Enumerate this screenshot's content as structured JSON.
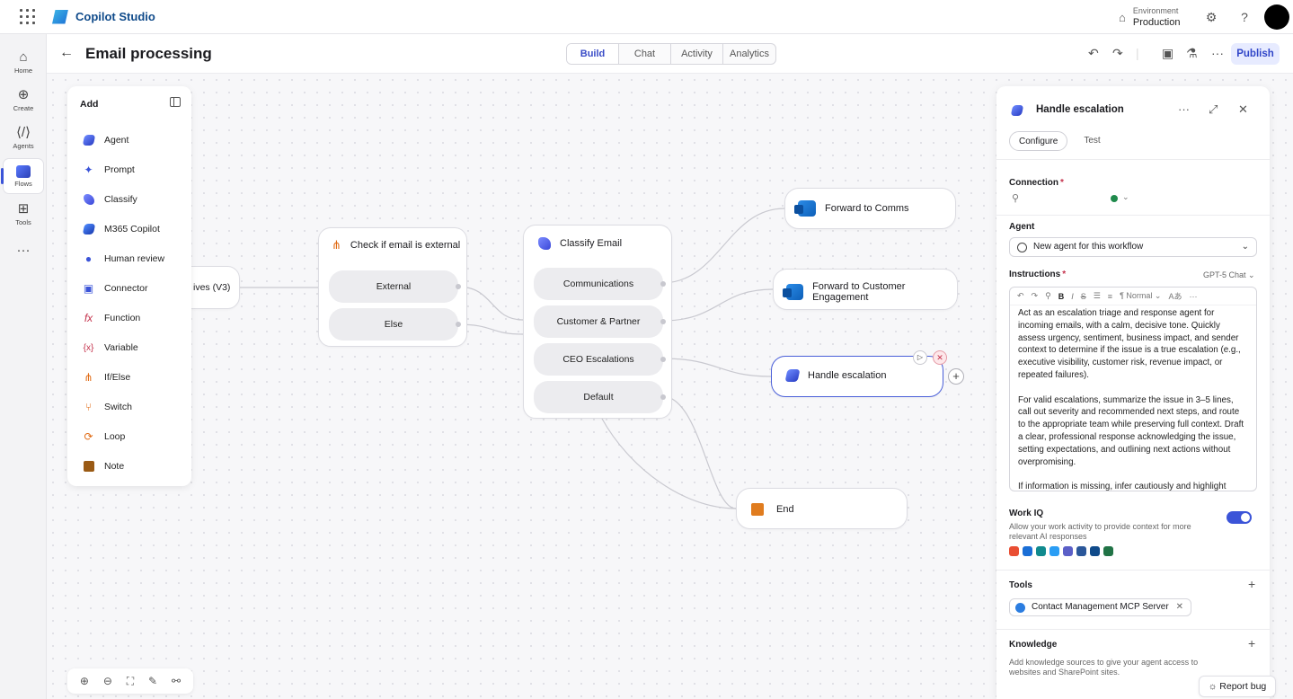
{
  "app": {
    "name": "Copilot Studio",
    "environment_label": "Environment",
    "environment_value": "Production"
  },
  "rail": [
    {
      "label": "Home",
      "icon": "home-icon"
    },
    {
      "label": "Create",
      "icon": "plus-circle-icon"
    },
    {
      "label": "Agents",
      "icon": "agents-icon"
    },
    {
      "label": "Flows",
      "icon": "flows-icon",
      "active": true
    },
    {
      "label": "Tools",
      "icon": "tools-icon"
    }
  ],
  "header": {
    "title": "Email processing",
    "tabs": [
      "Build",
      "Chat",
      "Activity",
      "Analytics"
    ],
    "active_tab": "Build",
    "publish_label": "Publish"
  },
  "add_panel": {
    "title": "Add",
    "items": [
      "Agent",
      "Prompt",
      "Classify",
      "M365 Copilot",
      "Human review",
      "Connector",
      "Function",
      "Variable",
      "If/Else",
      "Switch",
      "Loop",
      "Note"
    ]
  },
  "flow": {
    "trigger_partial": "ives (V3)",
    "check_node": {
      "title": "Check if email is external",
      "branches": [
        "External",
        "Else"
      ]
    },
    "classify_node": {
      "title": "Classify Email",
      "branches": [
        "Communications",
        "Customer & Partner",
        "CEO Escalations",
        "Default"
      ]
    },
    "forward_comms": "Forward to Comms",
    "forward_customer": "Forward to Customer Engagement",
    "handle_escalation": "Handle escalation",
    "end": "End"
  },
  "right_panel": {
    "title": "Handle escalation",
    "tabs": [
      "Configure",
      "Test"
    ],
    "connection_label": "Connection",
    "agent_label": "Agent",
    "agent_value": "New agent for this workflow",
    "instructions_label": "Instructions",
    "model": "GPT-5 Chat",
    "format_style": "Normal",
    "instructions": [
      "Act as an escalation triage and response agent for incoming emails, with a calm, decisive tone. Quickly assess urgency, sentiment, business impact, and sender context to determine if the issue is a true escalation (e.g., executive visibility, customer risk, revenue impact, or repeated failures).",
      "For valid escalations, summarize the issue in 3–5 lines, call out severity and recommended next steps, and route to the appropriate team while preserving full context. Draft a clear, professional response acknowledging the issue, setting expectations, and outlining next actions without overpromising.",
      "If information is missing, infer cautiously and highlight"
    ],
    "work_iq_label": "Work IQ",
    "work_iq_desc": "Allow your work activity to provide context for more relevant AI responses",
    "work_iq_enabled": true,
    "tools_label": "Tools",
    "tool_chip": "Contact Management MCP Server",
    "knowledge_label": "Knowledge",
    "knowledge_desc": "Add knowledge sources to give your agent access to websites and SharePoint sites."
  },
  "report_bug": "Report bug",
  "colors": {
    "accent": "#3b54d8",
    "orange": "#e07c1f"
  }
}
